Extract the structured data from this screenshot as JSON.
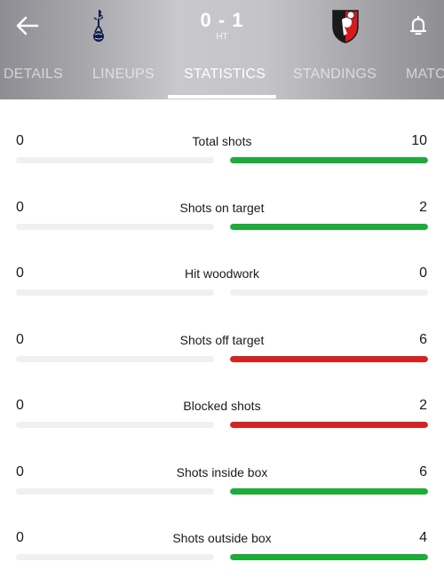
{
  "header": {
    "score": "0 - 1",
    "status": "HT",
    "icons": {
      "back": "arrow-left-icon",
      "notifications": "bell-icon",
      "home_team_crest": "tottenham-crest",
      "away_team_crest": "bournemouth-crest"
    }
  },
  "tabs": [
    {
      "label": "DETAILS",
      "active": false
    },
    {
      "label": "LINEUPS",
      "active": false
    },
    {
      "label": "STATISTICS",
      "active": true
    },
    {
      "label": "STANDINGS",
      "active": false
    },
    {
      "label": "MATC",
      "active": false
    }
  ],
  "colors": {
    "track": "#f0f0f0",
    "green": "#1fab3a",
    "red": "#d32424"
  },
  "stats": [
    {
      "label": "Total shots",
      "home": "0",
      "away": "10",
      "home_fraction": 0,
      "away_fraction": 1,
      "color": "green"
    },
    {
      "label": "Shots on target",
      "home": "0",
      "away": "2",
      "home_fraction": 0,
      "away_fraction": 1,
      "color": "green"
    },
    {
      "label": "Hit woodwork",
      "home": "0",
      "away": "0",
      "home_fraction": 0,
      "away_fraction": 0,
      "color": "green"
    },
    {
      "label": "Shots off target",
      "home": "0",
      "away": "6",
      "home_fraction": 0,
      "away_fraction": 1,
      "color": "red"
    },
    {
      "label": "Blocked shots",
      "home": "0",
      "away": "2",
      "home_fraction": 0,
      "away_fraction": 1,
      "color": "red"
    },
    {
      "label": "Shots inside box",
      "home": "0",
      "away": "6",
      "home_fraction": 0,
      "away_fraction": 1,
      "color": "green"
    },
    {
      "label": "Shots outside box",
      "home": "0",
      "away": "4",
      "home_fraction": 0,
      "away_fraction": 1,
      "color": "green"
    }
  ]
}
